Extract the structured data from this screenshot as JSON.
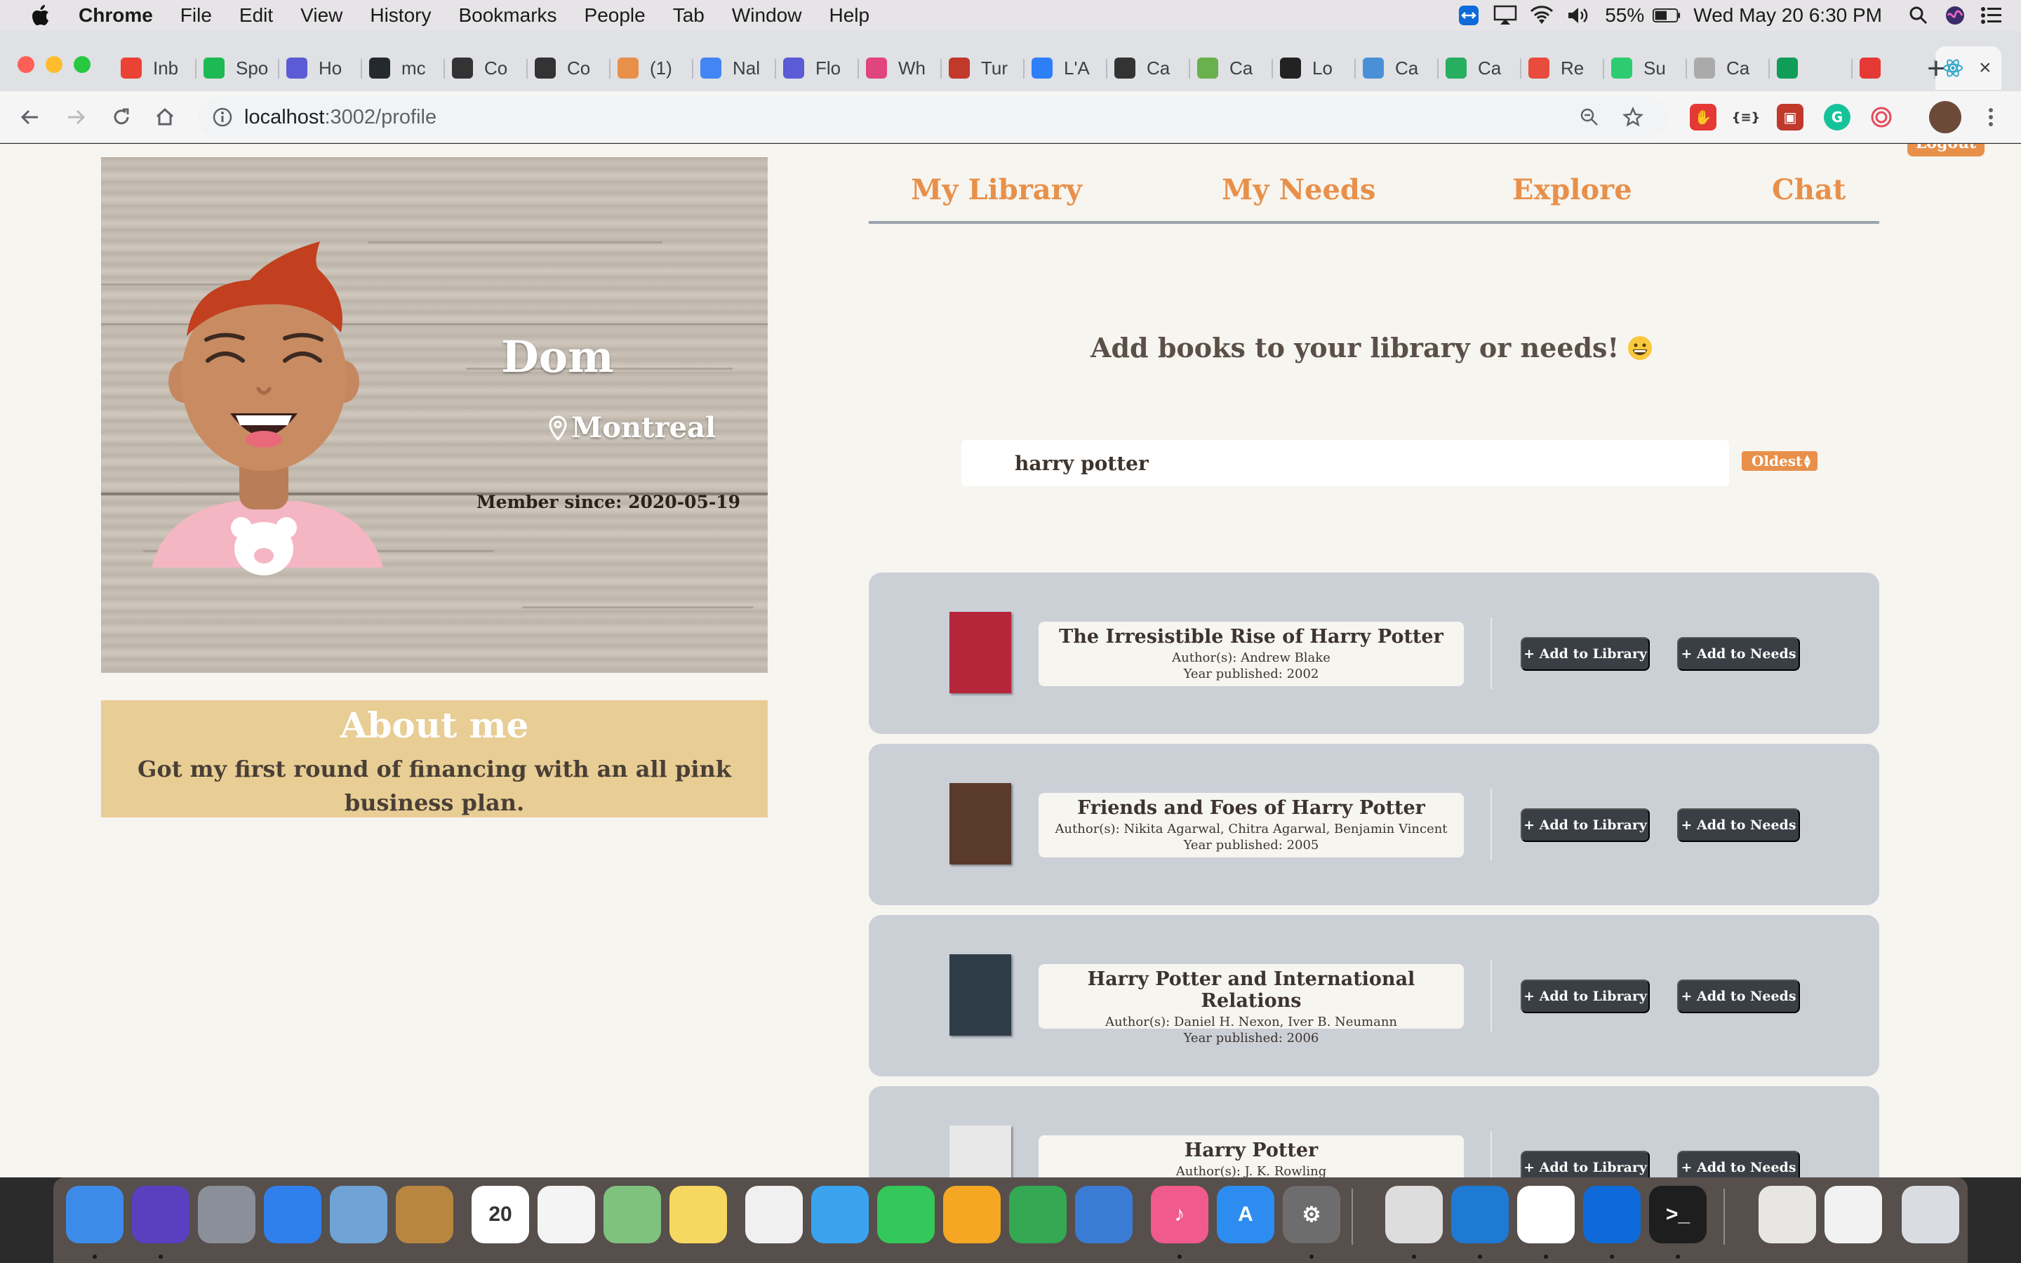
{
  "menubar": {
    "app_name": "Chrome",
    "menus": [
      "File",
      "Edit",
      "View",
      "History",
      "Bookmarks",
      "People",
      "Tab",
      "Window",
      "Help"
    ],
    "battery": "55%",
    "datetime": "Wed May 20  6:30 PM"
  },
  "browser": {
    "tabs": [
      {
        "label": "Inb",
        "icon": "gmail-icon",
        "color": "#ea4335"
      },
      {
        "label": "Spo",
        "icon": "spotify-icon",
        "color": "#1db954"
      },
      {
        "label": "Ho",
        "icon": "c-app-icon",
        "color": "#5b5bd6"
      },
      {
        "label": "mc",
        "icon": "github-icon",
        "color": "#24292e"
      },
      {
        "label": "Co",
        "icon": "plus-circle-icon",
        "color": "#333333"
      },
      {
        "label": "Co",
        "icon": "plus-circle-icon",
        "color": "#333333"
      },
      {
        "label": "(1)",
        "icon": "loading-icon",
        "color": "#e8904a"
      },
      {
        "label": "Nal",
        "icon": "docs-icon",
        "color": "#4285f4"
      },
      {
        "label": "Flo",
        "icon": "c-app-icon",
        "color": "#5b5bd6"
      },
      {
        "label": "Wh",
        "icon": "slash-icon",
        "color": "#e0457b"
      },
      {
        "label": "Tur",
        "icon": "magnet-icon",
        "color": "#c0392b"
      },
      {
        "label": "L'A",
        "icon": "diamond-icon",
        "color": "#2d7ff9"
      },
      {
        "label": "Ca",
        "icon": "check-circle-icon",
        "color": "#333333"
      },
      {
        "label": "Ca",
        "icon": "green-k-icon",
        "color": "#6ab04c"
      },
      {
        "label": "Lo",
        "icon": "lo-icon",
        "color": "#222222"
      },
      {
        "label": "Ca",
        "icon": "bird-icon",
        "color": "#4a90d9"
      },
      {
        "label": "Ca",
        "icon": "p-icon",
        "color": "#27ae60"
      },
      {
        "label": "Re",
        "icon": "house-icon",
        "color": "#e74c3c"
      },
      {
        "label": "Su",
        "icon": "cloud-up-icon",
        "color": "#2ecc71"
      },
      {
        "label": "Ca",
        "icon": "dash-icon",
        "color": "#aaaaaa"
      },
      {
        "label": "",
        "icon": "hangouts-icon",
        "color": "#0f9d58"
      },
      {
        "label": "",
        "icon": "record-icon",
        "color": "#e53935"
      }
    ],
    "url_host": "localhost",
    "url_path": ":3002/profile"
  },
  "page": {
    "logout_label": "Logout",
    "profile": {
      "name": "Dom",
      "location": "Montreal",
      "member_since": "Member since: 2020-05-19"
    },
    "about": {
      "title": "About me",
      "text": "Got my first round of financing with an all pink business plan."
    },
    "nav": [
      "My Library",
      "My Needs",
      "Explore",
      "Chat"
    ],
    "heading": "Add books to your library or needs!",
    "search": {
      "value": "harry potter"
    },
    "sort": {
      "selected": "Oldest"
    },
    "add_library_label": "+ Add to Library",
    "add_needs_label": "+ Add to Needs",
    "results": [
      {
        "title": "The Irresistible Rise of Harry Potter",
        "authors": "Author(s): Andrew Blake",
        "year": "Year published: 2002",
        "cover_color": "#b5263a"
      },
      {
        "title": "Friends and Foes of Harry Potter",
        "authors": "Author(s): Nikita Agarwal, Chitra Agarwal, Benjamin Vincent",
        "year": "Year published: 2005",
        "cover_color": "#5a3a2a"
      },
      {
        "title": "Harry Potter and International Relations",
        "authors": "Author(s): Daniel H. Nexon, Iver B. Neumann",
        "year": "Year published: 2006",
        "cover_color": "#2f3d48"
      },
      {
        "title": "Harry Potter",
        "authors": "Author(s): J. K. Rowling",
        "year": "",
        "cover_color": "#e8e8e8"
      }
    ]
  },
  "colors": {
    "accent": "#e8904a",
    "page_bg": "#f7f5f0",
    "result_bg": "#cbd0d7",
    "about_bg": "#e8cd94",
    "button_dark": "#3a3f45"
  },
  "dock": [
    {
      "name": "finder-icon",
      "color": "#3d8be8",
      "glyph": ""
    },
    {
      "name": "siri-icon",
      "color": "#5b3fbf",
      "glyph": ""
    },
    {
      "name": "launchpad-icon",
      "color": "#8a8f99",
      "glyph": ""
    },
    {
      "name": "safari-icon",
      "color": "#2f80ed",
      "glyph": ""
    },
    {
      "name": "mail-icon",
      "color": "#6fa3d6",
      "glyph": ""
    },
    {
      "name": "contacts-icon",
      "color": "#b8863f",
      "glyph": ""
    },
    {
      "name": "calendar-icon",
      "color": "#ffffff",
      "glyph": "20"
    },
    {
      "name": "reminders-icon",
      "color": "#f4f4f4",
      "glyph": ""
    },
    {
      "name": "maps-icon",
      "color": "#7ec27e",
      "glyph": ""
    },
    {
      "name": "notes-icon",
      "color": "#f6d860",
      "glyph": ""
    },
    {
      "name": "photos-icon",
      "color": "#f0f0f0",
      "glyph": ""
    },
    {
      "name": "messages-icon",
      "color": "#3aa3f0",
      "glyph": ""
    },
    {
      "name": "facetime-icon",
      "color": "#34c759",
      "glyph": ""
    },
    {
      "name": "pages-icon",
      "color": "#f5a623",
      "glyph": ""
    },
    {
      "name": "numbers-icon",
      "color": "#34a853",
      "glyph": ""
    },
    {
      "name": "keynote-icon",
      "color": "#3a7bd5",
      "glyph": ""
    },
    {
      "name": "itunes-icon",
      "color": "#f05a8c",
      "glyph": "♪"
    },
    {
      "name": "app-store-icon",
      "color": "#2d8cf0",
      "glyph": "A"
    },
    {
      "name": "system-preferences-icon",
      "color": "#6d6d6d",
      "glyph": "⚙"
    },
    {
      "name": "chrome-icon",
      "color": "#dddddd",
      "glyph": ""
    },
    {
      "name": "vscode-icon",
      "color": "#1f7ad4",
      "glyph": ""
    },
    {
      "name": "slack-icon",
      "color": "#ffffff",
      "glyph": ""
    },
    {
      "name": "teamviewer-icon",
      "color": "#0e6ad8",
      "glyph": ""
    },
    {
      "name": "terminal-icon",
      "color": "#1e1e1e",
      "glyph": ">_"
    },
    {
      "name": "user-folder-icon",
      "color": "#e8e6e3",
      "glyph": ""
    },
    {
      "name": "preview-icon",
      "color": "#f2f2f2",
      "glyph": ""
    },
    {
      "name": "trash-icon",
      "color": "#d9dde2",
      "glyph": ""
    }
  ]
}
